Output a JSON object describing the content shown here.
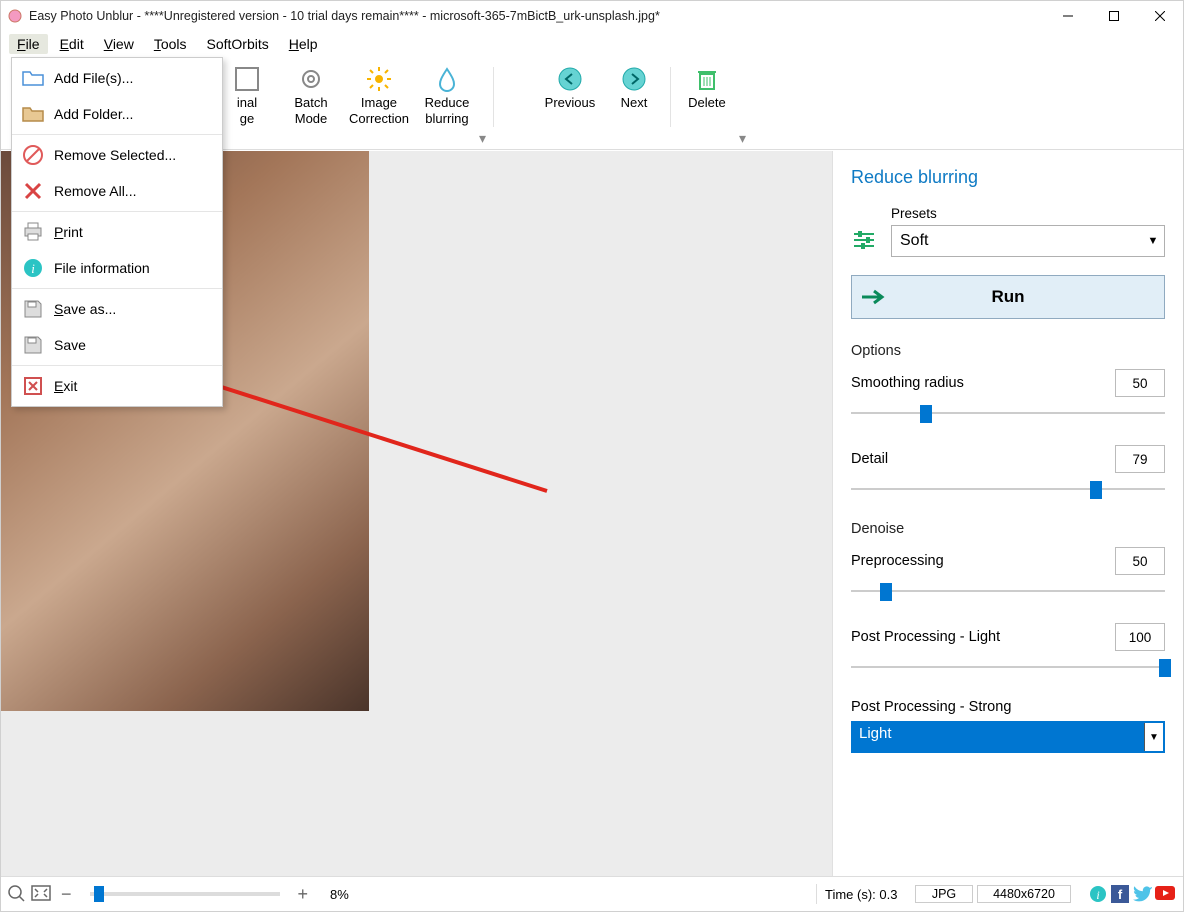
{
  "title": "Easy Photo Unblur - ****Unregistered version - 10 trial days remain**** - microsoft-365-7mBictB_urk-unsplash.jpg*",
  "menus": {
    "file": "File",
    "edit": "Edit",
    "view": "View",
    "tools": "Tools",
    "softorbits": "SoftOrbits",
    "help": "Help"
  },
  "file_menu": {
    "add_files": "Add File(s)...",
    "add_folder": "Add Folder...",
    "remove_selected": "Remove Selected...",
    "remove_all": "Remove All...",
    "print": "Print",
    "file_info": "File information",
    "save_as": "Save as...",
    "save": "Save",
    "exit": "Exit"
  },
  "toolbar": {
    "original_l1": "inal",
    "original_l2": "ge",
    "batch_l1": "Batch",
    "batch_l2": "Mode",
    "imgcorr_l1": "Image",
    "imgcorr_l2": "Correction",
    "reduce_l1": "Reduce",
    "reduce_l2": "blurring",
    "previous": "Previous",
    "next": "Next",
    "delete": "Delete"
  },
  "panel": {
    "title": "Reduce blurring",
    "presets_label": "Presets",
    "preset_value": "Soft",
    "run": "Run",
    "options": "Options",
    "smoothing_label": "Smoothing radius",
    "smoothing_val": "50",
    "smoothing_pct": 24,
    "detail_label": "Detail",
    "detail_val": "79",
    "detail_pct": 78,
    "denoise": "Denoise",
    "pre_label": "Preprocessing",
    "pre_val": "50",
    "pre_pct": 11,
    "postlight_label": "Post Processing - Light",
    "postlight_val": "100",
    "postlight_pct": 100,
    "poststrong_label": "Post Processing - Strong",
    "poststrong_val": "Light"
  },
  "status": {
    "zoom": "8%",
    "time": "Time (s): 0.3",
    "format": "JPG",
    "dims": "4480x6720"
  },
  "colors": {
    "accent": "#0076d1",
    "link": "#0e7ac4"
  }
}
